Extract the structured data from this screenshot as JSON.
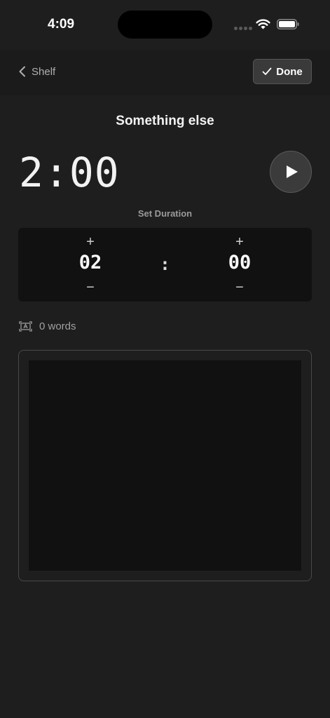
{
  "status_bar": {
    "time": "4:09",
    "wifi_icon": "wifi-icon",
    "battery_icon": "battery-icon"
  },
  "nav": {
    "back_label": "Shelf",
    "back_icon": "chevron-left-icon",
    "done_label": "Done",
    "done_icon": "checkmark-icon"
  },
  "session": {
    "title": "Something else",
    "timer_display": "2:00",
    "play_icon": "play-icon"
  },
  "duration": {
    "label": "Set Duration",
    "minutes": "02",
    "seconds": "00",
    "separator": ":",
    "increment_symbol": "+",
    "decrement_symbol": "−"
  },
  "word_count": {
    "icon": "text-box-icon",
    "text": "0 words"
  },
  "editor": {
    "value": ""
  },
  "colors": {
    "background": "#1e1e1e",
    "panel": "#111111",
    "accent_text": "#ffffff",
    "muted_text": "#a0a0a0"
  }
}
